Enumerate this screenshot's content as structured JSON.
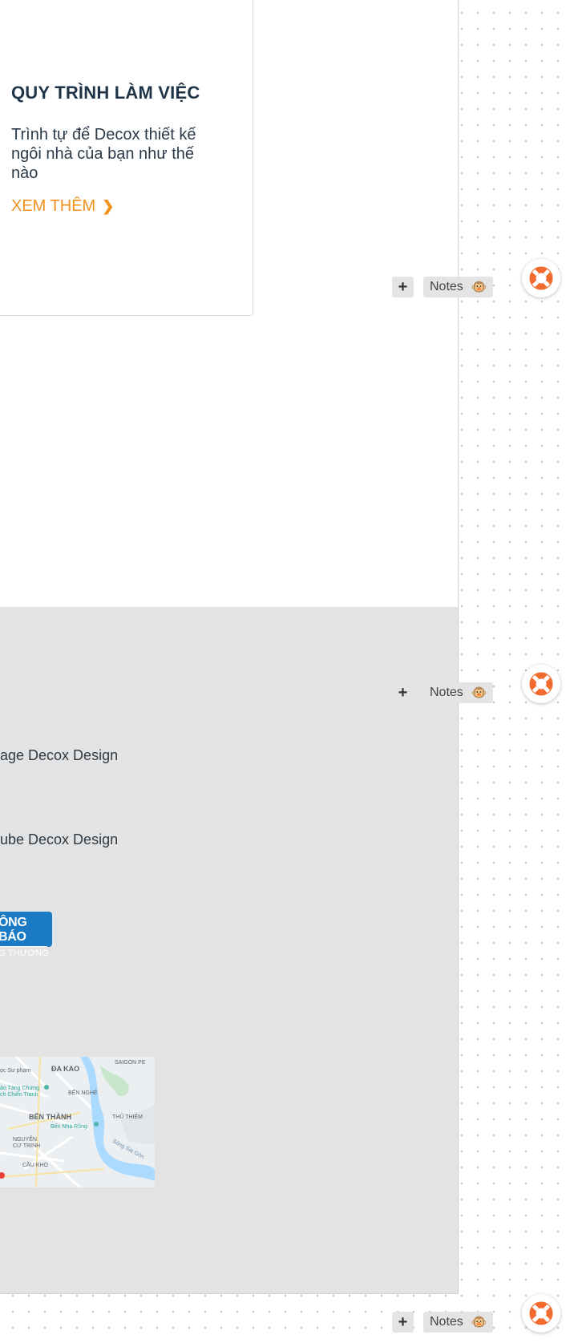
{
  "card": {
    "title": "QUY TRÌNH LÀM VIỆC",
    "description": "Trình tự để Decox thiết kế ngôi nhà của bạn như thế nào",
    "link_label": "XEM THÊM",
    "link_chevron": "❯"
  },
  "toolbars": [
    {
      "plus": "+",
      "notes": "Notes",
      "emoji": "🐵"
    },
    {
      "plus": "+",
      "notes": "Notes",
      "emoji": "🐵"
    },
    {
      "plus": "+",
      "notes": "Notes",
      "emoji": "🐵"
    }
  ],
  "footer": {
    "facebook_text": "age Decox Design",
    "youtube_text": "ube Decox Design",
    "badge_line1": "ÔNG BÁO",
    "badge_line2": "G THƯƠNG",
    "map_labels": {
      "da_kao": "ĐA KAO",
      "saigon": "SAIGON PE",
      "ben_nghe": "BẾN NGHÉ",
      "ben_thanh": "BẾN THÀNH",
      "thu_thiem": "THỦ THIÊM",
      "nguyen_cu_trinh": "NGUYỄN\nCƯ TRINH",
      "cau_kho": "CẦU KHO",
      "ben_nha_rong": "Bến Nhà Rồng",
      "su_pham": "ọc Sư phạm",
      "bao_tang": "ảo Tàng Chứng\nch Chiến Tranh",
      "song_sai_gon": "Sông Sài Gòn"
    }
  },
  "colors": {
    "accent": "#f2921d",
    "title": "#1f3347",
    "badge": "#1a7bc4",
    "help_orange": "#f26a2e",
    "gray_section": "#e3e3e3"
  },
  "icons": {
    "help": "lifebuoy-icon",
    "add": "plus-icon",
    "notes_emoji": "monkey-face-icon"
  }
}
